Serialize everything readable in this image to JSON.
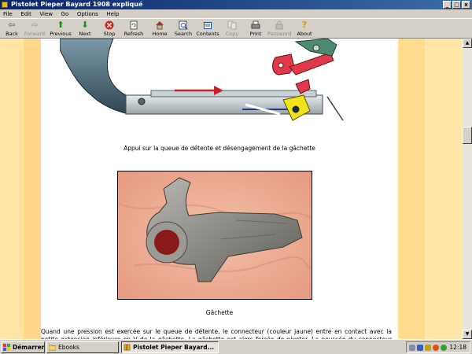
{
  "window": {
    "title": "Pistolet Pieper Bayard 1908 expliqué"
  },
  "window_buttons": [
    "_",
    "□",
    "x"
  ],
  "menu": [
    "File",
    "Edit",
    "View",
    "Go",
    "Options",
    "Help"
  ],
  "toolbar": [
    {
      "label": "Back",
      "icon": "back-arrow-icon",
      "enabled": true
    },
    {
      "label": "Forward",
      "icon": "forward-arrow-icon",
      "enabled": false
    },
    {
      "label": "Previous",
      "icon": "up-arrow-icon",
      "enabled": true
    },
    {
      "label": "Next",
      "icon": "down-arrow-icon",
      "enabled": true
    },
    {
      "label": "Stop",
      "icon": "stop-icon",
      "enabled": true
    },
    {
      "label": "Refresh",
      "icon": "refresh-icon",
      "enabled": true
    },
    {
      "label": "Home",
      "icon": "home-icon",
      "enabled": true
    },
    {
      "label": "Search",
      "icon": "search-icon",
      "enabled": true
    },
    {
      "label": "Contents",
      "icon": "contents-icon",
      "enabled": true
    },
    {
      "label": "Copy",
      "icon": "copy-icon",
      "enabled": false
    },
    {
      "label": "Print",
      "icon": "print-icon",
      "enabled": true
    },
    {
      "label": "Password",
      "icon": "password-icon",
      "enabled": false
    },
    {
      "label": "About",
      "icon": "about-icon",
      "enabled": true
    }
  ],
  "content": {
    "caption1": "Appui sur la queue de détente et désengagement de la gâchette",
    "caption2": "Gâchette",
    "paragraph": "Quand une pression est exercée sur le queue de détente, le connecteur (couleur jaune) entre en contact avec la petite extension inférieure en V de la gâchette. La gâchette est alors forcée de pivoter. La poussée du connecteur contre la"
  },
  "taskbar": {
    "start_label": "Démarrer",
    "tasks": [
      {
        "label": "Ebooks",
        "active": false
      },
      {
        "label": "Pistolet Pieper Bayard...",
        "active": true
      }
    ],
    "clock": "12:18"
  },
  "colors": {
    "title_bar": "#0a246a",
    "sidebar_left": "#ffe4a5",
    "sidebar_right": "#ffdd8c",
    "part_red": "#e0394a",
    "part_yellow": "#f2e21c"
  }
}
